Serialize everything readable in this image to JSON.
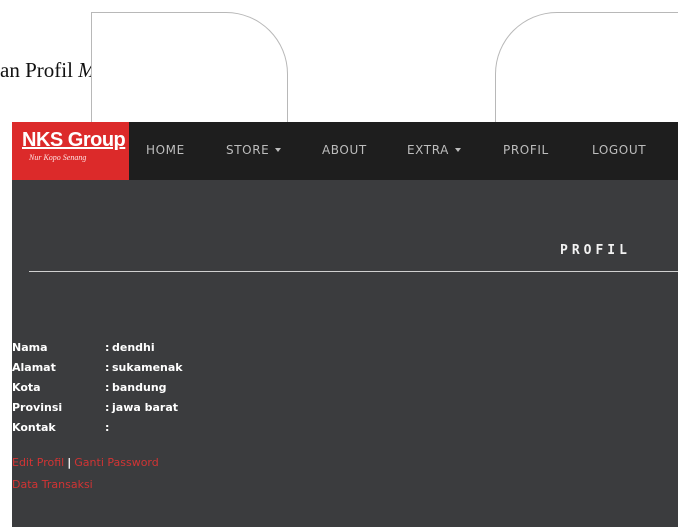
{
  "document": {
    "caption_prefix": "an Profil ",
    "caption_emphasis": "Member"
  },
  "navbar": {
    "brand_name": "NKS Group",
    "brand_tagline": "Nur Kopo Senang",
    "items": [
      {
        "label": "HOME",
        "has_caret": false
      },
      {
        "label": "STORE",
        "has_caret": true
      },
      {
        "label": "ABOUT",
        "has_caret": false
      },
      {
        "label": "EXTRA",
        "has_caret": true
      },
      {
        "label": "PROFIL",
        "has_caret": false
      },
      {
        "label": "LOGOUT",
        "has_caret": false
      }
    ]
  },
  "page": {
    "heading": "PROFIL"
  },
  "profile": {
    "separator": ":",
    "rows": [
      {
        "label": "Nama",
        "value": "dendhi"
      },
      {
        "label": "Alamat",
        "value": "sukamenak"
      },
      {
        "label": "Kota",
        "value": "bandung"
      },
      {
        "label": "Provinsi",
        "value": "jawa barat"
      },
      {
        "label": "Kontak",
        "value": ""
      }
    ]
  },
  "links": {
    "edit_profile": "Edit Profil",
    "divider": "|",
    "change_password": "Ganti Password",
    "transactions": "Data Transaksi"
  },
  "colors": {
    "brand_red": "#dc2a2a",
    "navbar_bg": "#1e1e1e",
    "content_bg": "#3b3c3e",
    "link_red": "#d13434"
  }
}
